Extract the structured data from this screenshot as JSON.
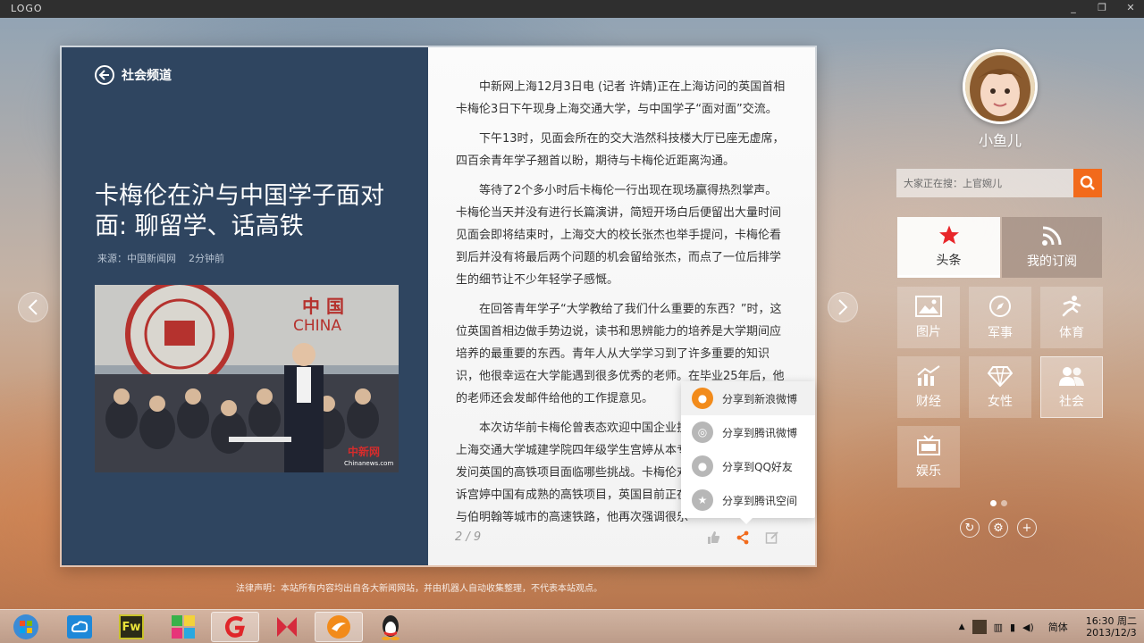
{
  "titlebar": {
    "logo": "LOGO",
    "min_glyph": "_",
    "max_glyph": "❐",
    "close_glyph": "✕"
  },
  "article": {
    "back_label": "社会频道",
    "headline": "卡梅伦在沪与中国学子面对面: 聊留学、话高铁",
    "source": "来源：中国新闻网",
    "time_ago": "2分钟前",
    "photo_caption_cn": "中 国",
    "photo_caption_en": "CHINA",
    "photo_watermark": "中新网",
    "photo_watermark_url": "Chinanews.com",
    "paragraphs": [
      "中新网上海12月3日电 (记者 许婧)正在上海访问的英国首相卡梅伦3日下午现身上海交通大学，与中国学子“面对面”交流。",
      "下午13时，见面会所在的交大浩然科技楼大厅已座无虚席，四百余青年学子翘首以盼，期待与卡梅伦近距离沟通。",
      "等待了2个多小时后卡梅伦一行出现在现场赢得热烈掌声。卡梅伦当天并没有进行长篇演讲，简短开场白后便留出大量时间见面会即将结束时，上海交大的校长张杰也举手提问，卡梅伦看到后并没有将最后两个问题的机会留给张杰，而点了一位后排学生的细节让不少年轻学子感慨。",
      "在回答青年学子“大学教给了我们什么重要的东西？”时，这位英国首相边做手势边说，读书和思辨能力的培养是大学期间应培养的最重要的东西。青年人从大学学习到了许多重要的知识识，他很幸运在大学能遇到很多优秀的老师。在毕业25年后，他的老师还会发邮件给他的工作提意见。",
      "本次访华前卡梅伦曾表态欢迎中国企业投",
      "上海交通大学城建学院四年级学生宫婷从本专",
      "发问英国的高铁项目面临哪些挑战。卡梅伦对",
      "诉宫婷中国有成熟的高铁项目，英国目前正在",
      "与伯明翰等城市的高速铁路，他再次强调很乐"
    ],
    "page_indicator": "2 / 9"
  },
  "share_menu": {
    "items": [
      {
        "label": "分享到新浪微博",
        "icon": "weibo-icon",
        "color": "#f28b1b"
      },
      {
        "label": "分享到腾讯微博",
        "icon": "tencent-weibo-icon",
        "color": "#b7b7b7"
      },
      {
        "label": "分享到QQ好友",
        "icon": "qq-icon",
        "color": "#b7b7b7"
      },
      {
        "label": "分享到腾讯空间",
        "icon": "qzone-icon",
        "color": "#b7b7b7"
      }
    ]
  },
  "user": {
    "name": "小鱼儿"
  },
  "search": {
    "placeholder": "大家正在搜：上官婉儿"
  },
  "tabs": [
    {
      "label": "头条",
      "icon": "star-icon"
    },
    {
      "label": "我的订阅",
      "icon": "rss-icon"
    }
  ],
  "categories": [
    {
      "label": "图片",
      "icon": "picture-icon"
    },
    {
      "label": "军事",
      "icon": "compass-icon"
    },
    {
      "label": "体育",
      "icon": "runner-icon"
    },
    {
      "label": "财经",
      "icon": "chart-icon"
    },
    {
      "label": "女性",
      "icon": "diamond-icon"
    },
    {
      "label": "社会",
      "icon": "people-icon"
    },
    {
      "label": "娱乐",
      "icon": "tv-icon"
    }
  ],
  "disclaimer": "法律声明：本站所有内容均出自各大新闻网站，并由机器人自动收集整理，不代表本站观点。",
  "taskbar": {
    "apps": [
      "windows-start-icon",
      "cloud-drive-icon",
      "fireworks-icon",
      "app-tiles-icon",
      "browser-g-icon",
      "media-icon",
      "news-app-icon",
      "qq-penguin-icon"
    ],
    "fw_label": "Fw",
    "ime": "简体",
    "time": "16:30 周二",
    "date": "2013/12/3"
  },
  "colors": {
    "accent": "#f26a1b",
    "left_pane": "#2f4560",
    "star": "#e8262a"
  }
}
